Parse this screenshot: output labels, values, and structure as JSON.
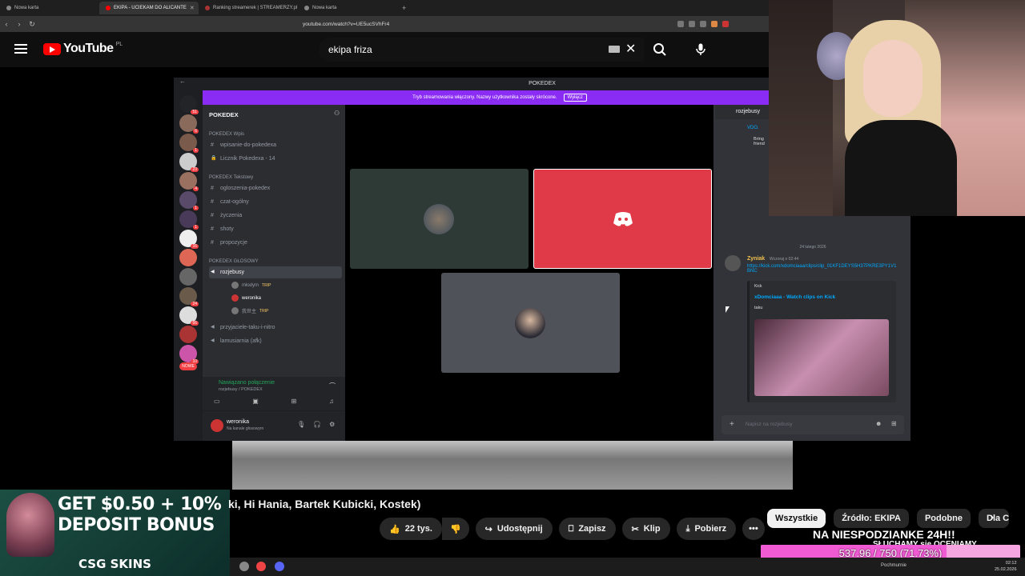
{
  "browser": {
    "tabs": [
      {
        "title": "Nowa karta"
      },
      {
        "title": "EKIPA - UCIEKAM DO ALICANTE",
        "active": true
      },
      {
        "title": "Ranking streamerek | STREAMERZY.pl"
      },
      {
        "title": "Nowa karta"
      }
    ],
    "new_tab": "+",
    "url": "youtube.com/watch?v=UE5ucSVhFr4"
  },
  "youtube": {
    "logo": "YouTube",
    "country": "PL",
    "search_value": "ekipa friza",
    "video_title_visible": "ki, Hi Hania, Bartek Kubicki, Kostek)",
    "actions": {
      "likes": "22 tys.",
      "share": "Udostępnij",
      "save": "Zapisz",
      "clip": "Klip",
      "download": "Pobierz",
      "more": "•••"
    },
    "chips": [
      "Wszystkie",
      "Źródło: EKIPA",
      "Podobne",
      "Dla C"
    ]
  },
  "discord": {
    "window_title": "POKEDEX",
    "banner_text": "Tryb streamowania włączony. Nazwy użytkownika zostały skrócone.",
    "banner_button": "Wyłącz",
    "server_name": "POKEDEX",
    "categories": [
      "POKEDEX Wpis",
      "POKEDEX Tekstowy",
      "POKEDEX GŁOSOWY"
    ],
    "channels_wpis": [
      "wpisanie-do-pokedexa",
      "Licznik Pokedexa - 14"
    ],
    "channels_text": [
      "ogloszenia-pokedex",
      "czat-ogólny",
      "życzenia",
      "shoty",
      "propozycje"
    ],
    "voice_channel": "rozjebusy",
    "voice_members": [
      {
        "name": "młodym",
        "tag": "TRIP"
      },
      {
        "name": "weronika",
        "tag": ""
      },
      {
        "name": "我世主",
        "tag": "TRIP"
      }
    ],
    "other_voice": [
      "przyjaciele-taku-i-nitro",
      "lamusiarnia (afk)"
    ],
    "connection": "Nawiązano połączenie",
    "connection_sub": "rozjebusy / POKEDEX",
    "user": "weronika",
    "user_status": "Na kanale głosowym",
    "server_badges": [
      "51",
      "6",
      "1",
      "23",
      "4",
      "1",
      "1",
      "16",
      "24",
      "66",
      "10",
      "NOWE"
    ],
    "chat": {
      "channel": "rozjebusy",
      "snippet_link": "VDO.",
      "snippet_text": "Bring friend",
      "date_divider": "24 lutego 2026",
      "author": "Zyniak",
      "timestamp": "Wczoraj o 02:44",
      "link": "https://kick.com/xdomciaaa/clips/clip_01KF1DEYS5H37PKRE3PY1V1BNC",
      "embed_site": "Kick",
      "embed_title": "xDomciaaa - Watch clips on Kick",
      "embed_desc": "taku",
      "input_placeholder": "Napisz na rozjebusy"
    }
  },
  "ad": {
    "line1": "GET $0.50 + 10%",
    "line2": "DEPOSIT BONUS",
    "brand": "CSG  SKINS"
  },
  "overlay": {
    "message": "NA NIESPODZIANKE 24H!!",
    "sub": "SŁUCHAMY się OCENIAMY",
    "goal_text": "537.96 / 750 (71.73%)",
    "goal_fraction": 0.7173
  },
  "taskbar": {
    "weather": "Pochmurnie",
    "time": "02:12",
    "date": "25.02.2026"
  },
  "colors": {
    "discord_banner": "#8b2cf5",
    "youtube_red": "#ff0000",
    "goal_fill": "#f05ad3"
  }
}
